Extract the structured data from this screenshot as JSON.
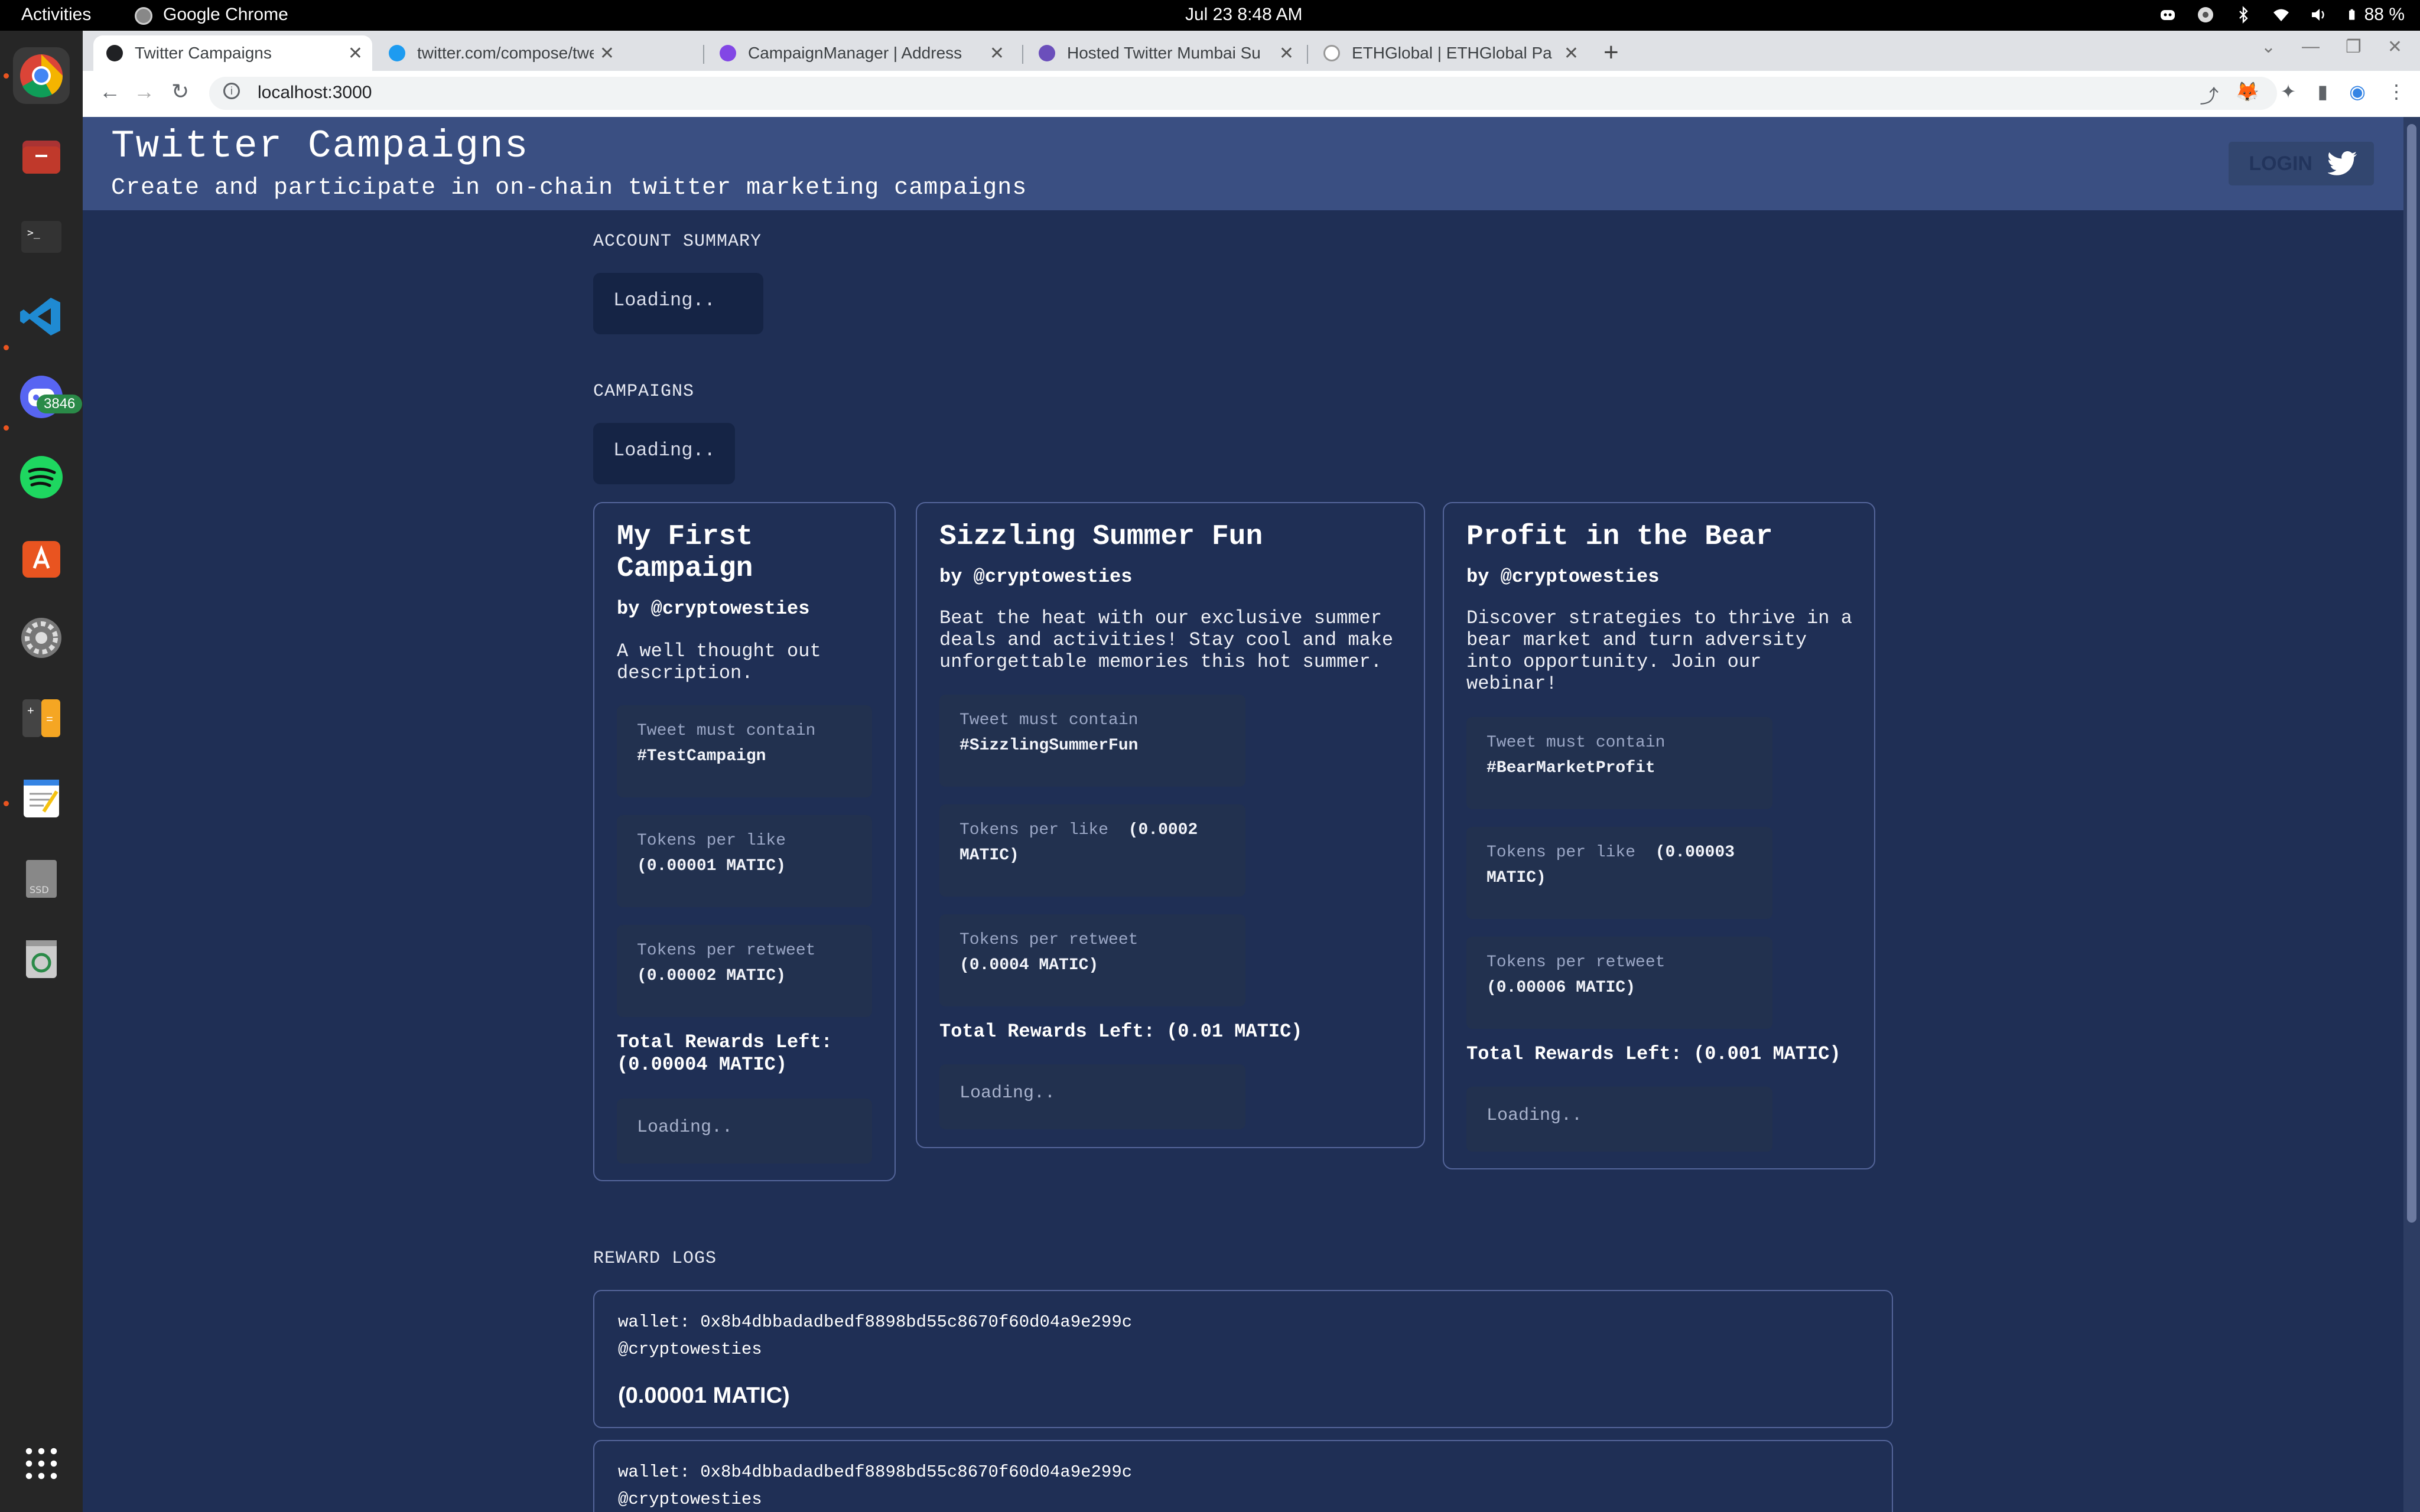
{
  "os": {
    "activities": "Activities",
    "app_name": "Google Chrome",
    "clock": "Jul 23   8:48 AM",
    "battery": "88 %",
    "discord_badge": "3846"
  },
  "browser": {
    "tabs": [
      {
        "title": "Twitter Campaigns",
        "active": true
      },
      {
        "title": "twitter.com/compose/tweet",
        "active": false
      },
      {
        "title": "CampaignManager | Address",
        "active": false
      },
      {
        "title": "Hosted Twitter Mumbai Su",
        "active": false
      },
      {
        "title": "ETHGlobal | ETHGlobal Pa",
        "active": false
      }
    ],
    "url": "localhost:3000"
  },
  "app": {
    "title": "Twitter Campaigns",
    "subtitle": "Create and participate in on-chain twitter marketing campaigns",
    "login_label": "LOGIN"
  },
  "account_summary": {
    "label": "ACCOUNT SUMMARY",
    "status": "Loading.."
  },
  "campaigns": {
    "label": "CAMPAIGNS",
    "status": "Loading..",
    "items": [
      {
        "title": "My First Campaign",
        "by": "by @cryptowesties",
        "description": "A well thought out description.",
        "tweet_must_contain_label": "Tweet must contain",
        "hashtag": "#TestCampaign",
        "per_like_label": "Tokens per like",
        "per_like": "(0.00001 MATIC)",
        "per_retweet_label": "Tokens per retweet",
        "per_retweet": "(0.00002 MATIC)",
        "total_label": "Total Rewards Left:",
        "total": "(0.00004 MATIC)",
        "status": "Loading.."
      },
      {
        "title": "Sizzling Summer Fun",
        "by": "by @cryptowesties",
        "description": "Beat the heat with our exclusive summer deals and activities! Stay cool and make unforgettable memories this hot summer.",
        "tweet_must_contain_label": "Tweet must contain",
        "hashtag": "#SizzlingSummerFun",
        "per_like_label": "Tokens per like",
        "per_like": "(0.0002 MATIC)",
        "per_retweet_label": "Tokens per retweet",
        "per_retweet": "(0.0004 MATIC)",
        "total_label": "Total Rewards Left:",
        "total": "(0.01 MATIC)",
        "status": "Loading.."
      },
      {
        "title": "Profit in the Bear",
        "by": "by @cryptowesties",
        "description": "Discover strategies to thrive in a bear market and turn adversity into opportunity. Join our webinar!",
        "tweet_must_contain_label": "Tweet must contain",
        "hashtag": "#BearMarketProfit",
        "per_like_label": "Tokens per like",
        "per_like": "(0.00003 MATIC)",
        "per_retweet_label": "Tokens per retweet",
        "per_retweet": "(0.00006 MATIC)",
        "total_label": "Total Rewards Left:",
        "total": "(0.001 MATIC)",
        "status": "Loading.."
      }
    ]
  },
  "reward_logs": {
    "label": "REWARD LOGS",
    "items": [
      {
        "wallet": "wallet: 0x8b4dbbadadbedf8898bd55c8670f60d04a9e299c",
        "handle": "@cryptowesties",
        "amount": "(0.00001 MATIC)"
      },
      {
        "wallet": "wallet: 0x8b4dbbadadbedf8898bd55c8670f60d04a9e299c",
        "handle": "@cryptowesties",
        "amount": ""
      }
    ]
  }
}
